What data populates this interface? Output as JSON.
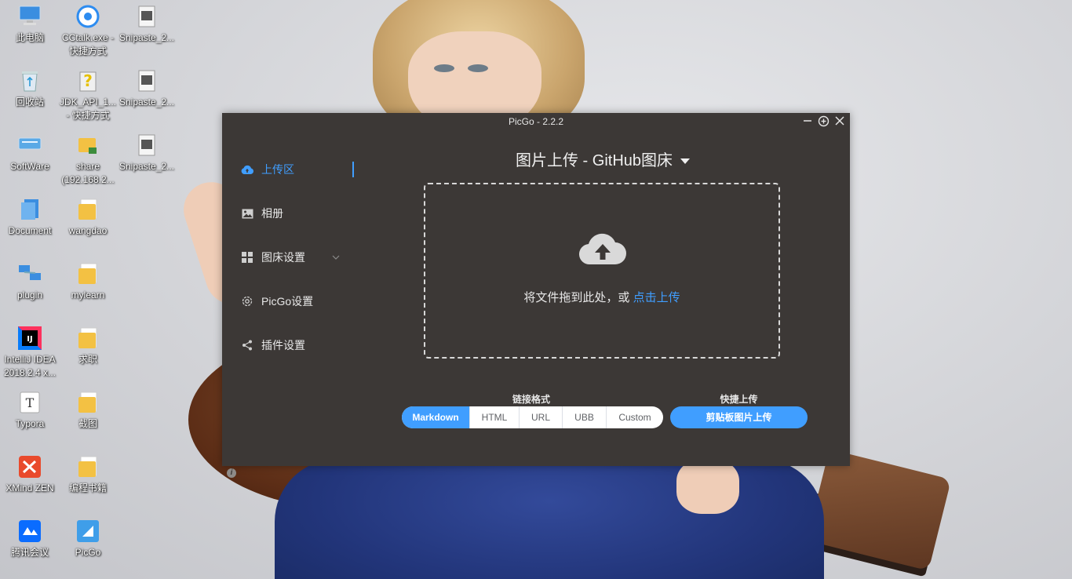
{
  "desktop": {
    "icons": [
      {
        "label": "此电脑",
        "icon": "computer-icon"
      },
      {
        "label": "CCtalk.exe -\n快捷方式",
        "icon": "cctalk-icon"
      },
      {
        "label": "Snipaste_2...",
        "icon": "image-file-icon"
      },
      {
        "label": "回收站",
        "icon": "recycle-bin-icon"
      },
      {
        "label": "JDK_API_1...\n- 快捷方式",
        "icon": "help-file-icon"
      },
      {
        "label": "Snipaste_2...",
        "icon": "image-file-icon"
      },
      {
        "label": "SoftWare",
        "icon": "drive-icon"
      },
      {
        "label": "share\n(192.168.2...",
        "icon": "network-folder-icon"
      },
      {
        "label": "Snipaste_2...",
        "icon": "image-file-icon"
      },
      {
        "label": "Document",
        "icon": "folder-shortcut-icon"
      },
      {
        "label": "wangdao",
        "icon": "folder-icon"
      },
      {
        "label": "plugin",
        "icon": "network-icon"
      },
      {
        "label": "mylearn",
        "icon": "folder-icon"
      },
      {
        "label": "IntelliJ IDEA\n2018.2.4 x...",
        "icon": "intellij-icon"
      },
      {
        "label": "求职",
        "icon": "folder-icon"
      },
      {
        "label": "Typora",
        "icon": "typora-icon"
      },
      {
        "label": "截图",
        "icon": "folder-icon"
      },
      {
        "label": "XMind ZEN",
        "icon": "xmind-icon"
      },
      {
        "label": "编程书籍",
        "icon": "folder-icon"
      },
      {
        "label": "腾讯会议",
        "icon": "tencent-meeting-icon"
      },
      {
        "label": "PicGo",
        "icon": "picgo-icon"
      }
    ]
  },
  "window": {
    "title": "PicGo - 2.2.2"
  },
  "sidebar": {
    "items": [
      {
        "label": "上传区",
        "icon": "cloud-upload-icon",
        "active": true
      },
      {
        "label": "相册",
        "icon": "picture-icon"
      },
      {
        "label": "图床设置",
        "icon": "grid-icon"
      },
      {
        "label": "PicGo设置",
        "icon": "gear-icon"
      },
      {
        "label": "插件设置",
        "icon": "share-icon"
      }
    ]
  },
  "main": {
    "title": "图片上传 - GitHub图床",
    "drop_text": "将文件拖到此处，或",
    "drop_link": "点击上传",
    "link_format_label": "链接格式",
    "quick_upload_label": "快捷上传",
    "formats": [
      "Markdown",
      "HTML",
      "URL",
      "UBB",
      "Custom"
    ],
    "selected_format": "Markdown",
    "clipboard_button": "剪贴板图片上传"
  },
  "colors": {
    "accent": "#409eff",
    "window_bg": "#3c3836"
  }
}
